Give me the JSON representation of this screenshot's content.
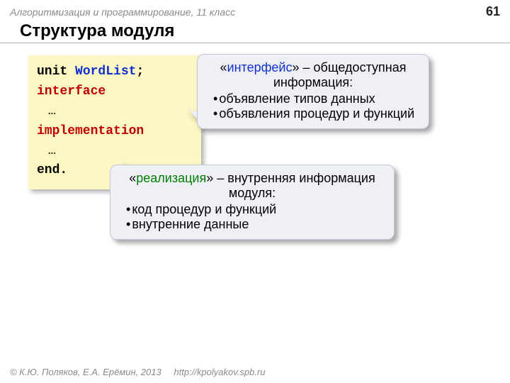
{
  "header": {
    "course": "Алгоритмизация и программирование, 11 класс",
    "page": "61"
  },
  "title": "Структура модуля",
  "code": {
    "unit_kw": "unit",
    "unit_name": "WordList",
    "semicolon": ";",
    "interface_kw": "interface",
    "dots1": "…",
    "implementation_kw": "implementation",
    "dots2": "…",
    "end_kw": "end."
  },
  "callout_interface": {
    "quote_open": "«",
    "keyword": "интерфейс",
    "quote_rest": "» – общедоступная информация:",
    "bullets": [
      "объявление типов данных",
      "объявления процедур и функций"
    ]
  },
  "callout_impl": {
    "quote_open": "«",
    "keyword": "реализация",
    "quote_rest": "» – внутренняя информация модуля:",
    "bullets": [
      "код процедур и функций",
      "внутренние данные"
    ]
  },
  "footer": {
    "copyright": "© К.Ю. Поляков, Е.А. Ерёмин, 2013",
    "link": "http://kpolyakov.spb.ru"
  }
}
